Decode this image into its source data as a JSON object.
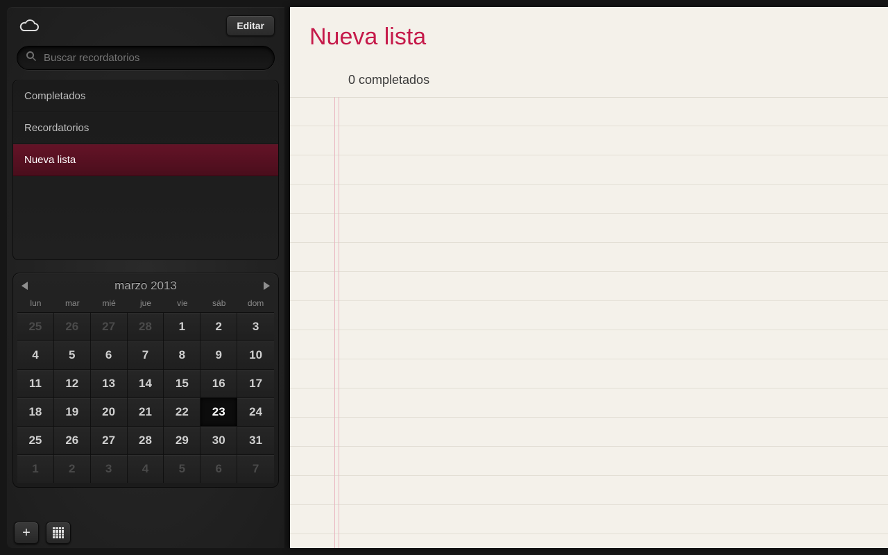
{
  "header": {
    "edit_label": "Editar"
  },
  "search": {
    "placeholder": "Buscar recordatorios"
  },
  "sidebar": {
    "items": [
      {
        "label": "Completados",
        "selected": false
      },
      {
        "label": "Recordatorios",
        "selected": false
      },
      {
        "label": "Nueva lista",
        "selected": true
      }
    ]
  },
  "calendar": {
    "title": "marzo 2013",
    "dow": [
      "lun",
      "mar",
      "mié",
      "jue",
      "vie",
      "sáb",
      "dom"
    ],
    "weeks": [
      [
        {
          "n": 25,
          "other": true
        },
        {
          "n": 26,
          "other": true
        },
        {
          "n": 27,
          "other": true
        },
        {
          "n": 28,
          "other": true
        },
        {
          "n": 1
        },
        {
          "n": 2
        },
        {
          "n": 3
        }
      ],
      [
        {
          "n": 4
        },
        {
          "n": 5
        },
        {
          "n": 6
        },
        {
          "n": 7
        },
        {
          "n": 8
        },
        {
          "n": 9
        },
        {
          "n": 10
        }
      ],
      [
        {
          "n": 11
        },
        {
          "n": 12
        },
        {
          "n": 13
        },
        {
          "n": 14
        },
        {
          "n": 15
        },
        {
          "n": 16
        },
        {
          "n": 17
        }
      ],
      [
        {
          "n": 18
        },
        {
          "n": 19
        },
        {
          "n": 20
        },
        {
          "n": 21
        },
        {
          "n": 22
        },
        {
          "n": 23,
          "today": true
        },
        {
          "n": 24
        }
      ],
      [
        {
          "n": 25
        },
        {
          "n": 26
        },
        {
          "n": 27
        },
        {
          "n": 28
        },
        {
          "n": 29
        },
        {
          "n": 30
        },
        {
          "n": 31
        }
      ],
      [
        {
          "n": 1,
          "other": true
        },
        {
          "n": 2,
          "other": true
        },
        {
          "n": 3,
          "other": true
        },
        {
          "n": 4,
          "other": true
        },
        {
          "n": 5,
          "other": true
        },
        {
          "n": 6,
          "other": true
        },
        {
          "n": 7,
          "other": true
        }
      ]
    ]
  },
  "main": {
    "title": "Nueva lista",
    "completed_label": "0 completados"
  }
}
